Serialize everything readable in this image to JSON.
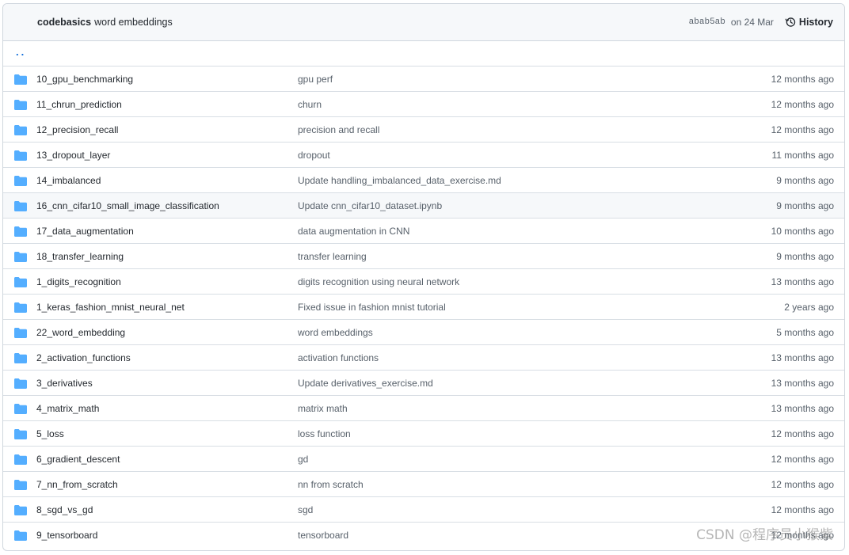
{
  "header": {
    "author": "codebasics",
    "commit_message": "word embeddings",
    "sha": "abab5ab",
    "date": "on 24 Mar",
    "history_label": "History"
  },
  "parent_link": "..",
  "files": [
    {
      "name": "10_gpu_benchmarking",
      "message": "gpu perf",
      "age": "12 months ago"
    },
    {
      "name": "11_chrun_prediction",
      "message": "churn",
      "age": "12 months ago"
    },
    {
      "name": "12_precision_recall",
      "message": "precision and recall",
      "age": "12 months ago"
    },
    {
      "name": "13_dropout_layer",
      "message": "dropout",
      "age": "11 months ago"
    },
    {
      "name": "14_imbalanced",
      "message": "Update handling_imbalanced_data_exercise.md",
      "age": "9 months ago"
    },
    {
      "name": "16_cnn_cifar10_small_image_classification",
      "message": "Update cnn_cifar10_dataset.ipynb",
      "age": "9 months ago"
    },
    {
      "name": "17_data_augmentation",
      "message": "data augmentation in CNN",
      "age": "10 months ago"
    },
    {
      "name": "18_transfer_learning",
      "message": "transfer learning",
      "age": "9 months ago"
    },
    {
      "name": "1_digits_recognition",
      "message": "digits recognition using neural network",
      "age": "13 months ago"
    },
    {
      "name": "1_keras_fashion_mnist_neural_net",
      "message": "Fixed issue in fashion mnist tutorial",
      "age": "2 years ago"
    },
    {
      "name": "22_word_embedding",
      "message": "word embeddings",
      "age": "5 months ago"
    },
    {
      "name": "2_activation_functions",
      "message": "activation functions",
      "age": "13 months ago"
    },
    {
      "name": "3_derivatives",
      "message": "Update derivatives_exercise.md",
      "age": "13 months ago"
    },
    {
      "name": "4_matrix_math",
      "message": "matrix math",
      "age": "13 months ago"
    },
    {
      "name": "5_loss",
      "message": "loss function",
      "age": "12 months ago"
    },
    {
      "name": "6_gradient_descent",
      "message": "gd",
      "age": "12 months ago"
    },
    {
      "name": "7_nn_from_scratch",
      "message": "nn from scratch",
      "age": "12 months ago"
    },
    {
      "name": "8_sgd_vs_gd",
      "message": "sgd",
      "age": "12 months ago"
    },
    {
      "name": "9_tensorboard",
      "message": "tensorboard",
      "age": "12 months ago"
    }
  ],
  "hovered_row": 5,
  "watermark": "CSDN @程序员小猴紫",
  "colors": {
    "folder": "#54aeff",
    "link": "#0969da",
    "muted": "#57606a",
    "border": "#d0d7de",
    "header_bg": "#f6f8fa"
  }
}
